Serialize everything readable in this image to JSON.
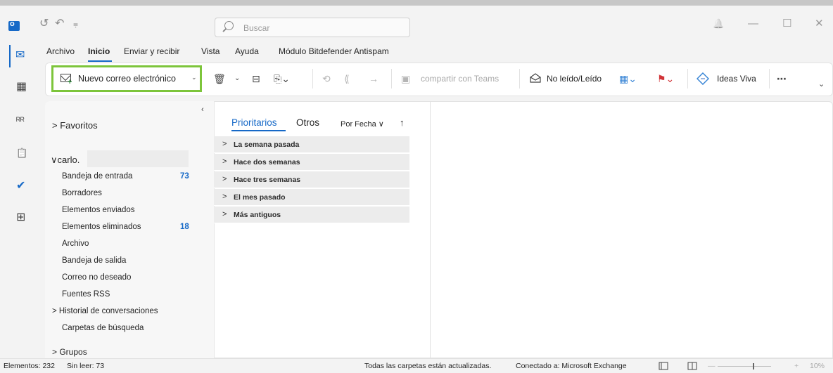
{
  "titlebar": {
    "search_placeholder": "Buscar",
    "undo_glyph": "↺",
    "redo_glyph": "↶",
    "qat_glyph": "⩦",
    "bell_glyph": "🔔",
    "minimize_glyph": "—",
    "maximize_glyph": "☐",
    "close_glyph": "✕"
  },
  "tabs": [
    {
      "label": "Archivo"
    },
    {
      "label": "Inicio"
    },
    {
      "label": "Enviar y recibir"
    },
    {
      "label": "Vista"
    },
    {
      "label": "Ayuda"
    },
    {
      "label": "Módulo Bitdefender Antispam"
    }
  ],
  "ribbon": {
    "new_mail_label": "Nuevo correo electrónico",
    "new_mail_chevron": "⌄",
    "delete_glyph": "🗑",
    "delete_chevron": "⌄",
    "archive_glyph": "⊟",
    "move_glyph": "⎘⌄",
    "reply_glyph": "⟲",
    "reply_all_glyph": "⟪",
    "forward_glyph": "→",
    "teams_glyph": "▣",
    "teams_label": "compartir con Teams",
    "read_unread_label": "No leído/Leído",
    "categorize_glyph": "▦⌄",
    "flag_glyph": "⚑⌄",
    "viva_label": "Ideas Viva",
    "more_glyph": "⋯",
    "expand_glyph": "⌄"
  },
  "appbar": {
    "mail_glyph": "✉",
    "calendar_glyph": "▦",
    "people_glyph": "ᴿᴿ",
    "tasks_glyph": "📋",
    "todo_glyph": "✔",
    "apps_glyph": "⊞"
  },
  "folders": {
    "collapse_glyph": "‹",
    "favorites": "> Favoritos",
    "account": "∨carlo.",
    "items": [
      {
        "label": "Bandeja de entrada",
        "count": "73"
      },
      {
        "label": "Borradores",
        "count": ""
      },
      {
        "label": "Elementos enviados",
        "count": ""
      },
      {
        "label": "Elementos eliminados",
        "count": "18"
      },
      {
        "label": "Archivo",
        "count": ""
      },
      {
        "label": "Bandeja de salida",
        "count": ""
      },
      {
        "label": "Correo no deseado",
        "count": ""
      },
      {
        "label": "Fuentes RSS",
        "count": ""
      }
    ],
    "history": "> Historial de conversaciones",
    "search_folders": "Carpetas de búsqueda",
    "groups": "> Grupos"
  },
  "message_list": {
    "tab_focused": "Prioritarios",
    "tab_other": "Otros",
    "sort_label": "Por Fecha ∨",
    "sort_arrow": "↑",
    "groups": [
      {
        "label": "La semana pasada"
      },
      {
        "label": "Hace dos semanas"
      },
      {
        "label": "Hace tres semanas"
      },
      {
        "label": "El mes pasado"
      },
      {
        "label": "Más antiguos"
      }
    ]
  },
  "status": {
    "items": "Elementos: 232",
    "unread": "Sin leer: 73",
    "sync": "Todas las carpetas están actualizadas.",
    "connection": "Conectado a: Microsoft Exchange",
    "zoom_minus": "—",
    "zoom_plus": "+",
    "zoom": "10%"
  },
  "colors": {
    "accent": "#1669c7",
    "highlight_border": "#7dc53b"
  }
}
